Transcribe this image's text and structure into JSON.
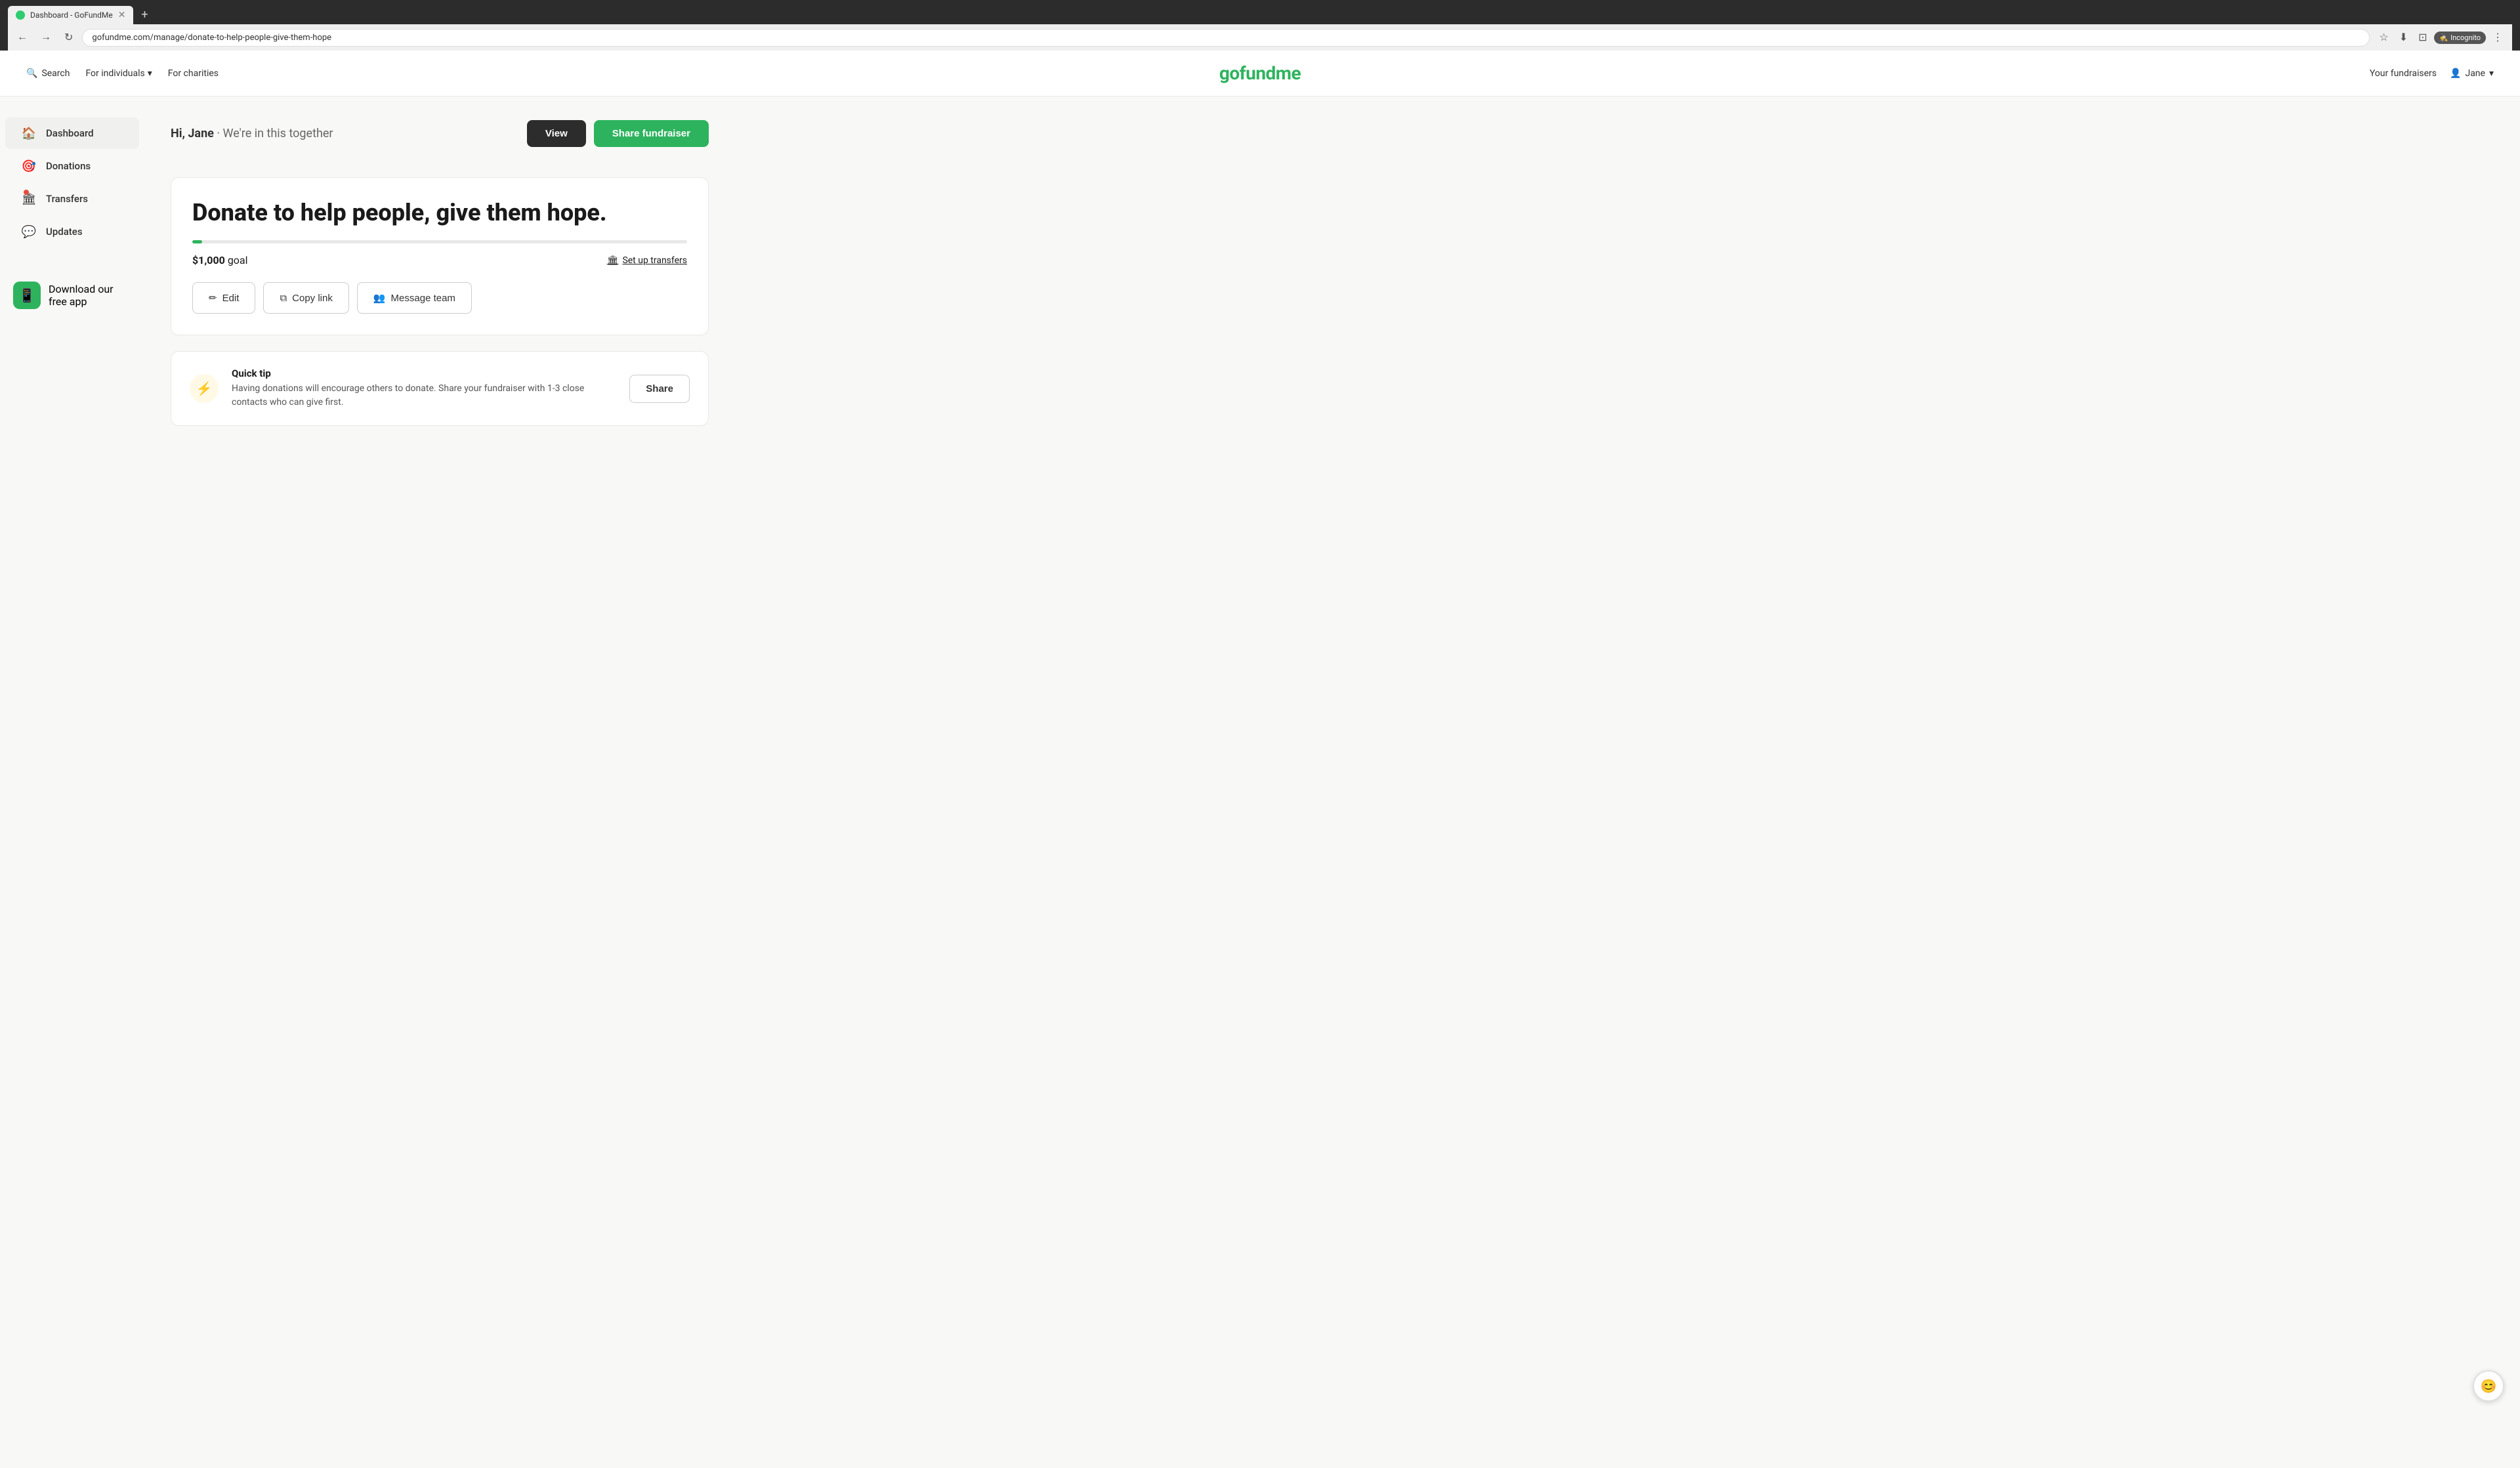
{
  "browser": {
    "tab_title": "Dashboard - GoFundMe",
    "tab_favicon": "🟢",
    "new_tab_label": "+",
    "address": "gofundme.com/manage/donate-to-help-people-give-them-hope",
    "incognito_label": "Incognito"
  },
  "header": {
    "search_label": "Search",
    "for_individuals_label": "For individuals",
    "for_charities_label": "For charities",
    "logo_text": "gofundme",
    "your_fundraisers_label": "Your fundraisers",
    "user_name": "Jane"
  },
  "sidebar": {
    "items": [
      {
        "id": "dashboard",
        "label": "Dashboard",
        "icon": "🏠",
        "active": true,
        "notification": false
      },
      {
        "id": "donations",
        "label": "Donations",
        "icon": "🎯",
        "active": false,
        "notification": false
      },
      {
        "id": "transfers",
        "label": "Transfers",
        "icon": "🏛",
        "active": false,
        "notification": true
      },
      {
        "id": "updates",
        "label": "Updates",
        "icon": "💬",
        "active": false,
        "notification": false
      }
    ],
    "download_app_label": "Download our free app"
  },
  "content": {
    "greeting": "Hi, Jane",
    "subtitle": "We're in this together",
    "view_button_label": "View",
    "share_button_label": "Share fundraiser",
    "fundraiser_title": "Donate to help people, give them hope.",
    "progress_percent": 2,
    "goal_amount": "$1,000",
    "goal_label": "goal",
    "setup_transfers_label": "Set up transfers",
    "edit_label": "Edit",
    "copy_link_label": "Copy link",
    "message_team_label": "Message team"
  },
  "quick_tip": {
    "label": "Quick tip",
    "text": "Having donations will encourage others to donate. Share your fundraiser with 1-3 close contacts who can give first.",
    "share_label": "Share"
  },
  "icons": {
    "search": "🔍",
    "chevron_down": "▾",
    "user": "👤",
    "back": "←",
    "forward": "→",
    "reload": "↻",
    "star": "☆",
    "download": "⬇",
    "extend": "⊡",
    "more": "⋮",
    "edit": "✏",
    "copy": "⧉",
    "message": "👥",
    "bank": "🏛",
    "lightning": "⚡",
    "chat": "😊"
  }
}
